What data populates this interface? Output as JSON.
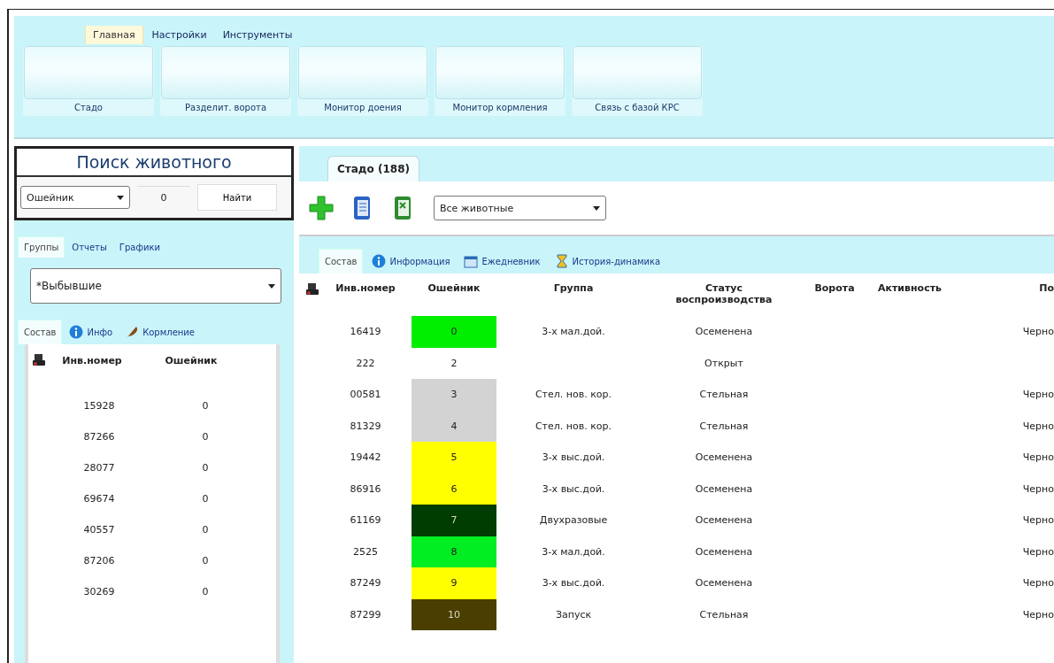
{
  "ribbon": {
    "tabs": [
      {
        "label": "Главная",
        "selected": true
      },
      {
        "label": "Настройки",
        "selected": false
      },
      {
        "label": "Инструменты",
        "selected": false
      }
    ],
    "buttons": [
      "Стадо",
      "Разделит. ворота",
      "Монитор доения",
      "Монитор кормления",
      "Связь с базой КРС"
    ]
  },
  "search": {
    "title": "Поиск животного",
    "field": "Ошейник",
    "value": "0",
    "button": "Найти"
  },
  "left_tabs": [
    {
      "label": "Группы",
      "selected": true
    },
    {
      "label": "Отчеты",
      "selected": false
    },
    {
      "label": "Графики",
      "selected": false
    }
  ],
  "group_select": "*Выбывшие",
  "left_subtabs": [
    {
      "label": "Состав",
      "selected": true
    },
    {
      "label": "Инфо",
      "selected": false
    },
    {
      "label": "Кормление",
      "selected": false
    }
  ],
  "left_table": {
    "columns": [
      "Инв.номер",
      "Ошейник"
    ],
    "rows": [
      [
        "15928",
        "0"
      ],
      [
        "87266",
        "0"
      ],
      [
        "28077",
        "0"
      ],
      [
        "69674",
        "0"
      ],
      [
        "40557",
        "0"
      ],
      [
        "87206",
        "0"
      ],
      [
        "30269",
        "0"
      ]
    ]
  },
  "main_tab": {
    "label": "Стадо (188)",
    "selected": true
  },
  "filter_select": "Все животные",
  "main_subtabs": [
    {
      "label": "Состав",
      "selected": true
    },
    {
      "label": "Информация",
      "selected": false
    },
    {
      "label": "Ежедневник",
      "selected": false
    },
    {
      "label": "История-динамика",
      "selected": false
    }
  ],
  "table": {
    "columns": [
      "Инв.номер",
      "Ошейник",
      "Группа",
      "Статус воспроизводства",
      "Ворота",
      "Активность",
      "По"
    ],
    "rows": [
      {
        "id": "16419",
        "collar": "0",
        "color": "#00ee00",
        "group": "3-х мал.дой.",
        "status": "Осеменена",
        "col_7": "Черно"
      },
      {
        "id": "222",
        "collar": "2",
        "group": "",
        "status": "Открыт",
        "col_7": ""
      },
      {
        "id": "00581",
        "collar": "3",
        "color": "#d3d3d3",
        "group": "Стел. нов. кор.",
        "status": "Стельная",
        "col_7": "Черно"
      },
      {
        "id": "81329",
        "collar": "4",
        "color": "#d3d3d3",
        "group": "Стел. нов. кор.",
        "status": "Стельная",
        "col_7": "Черно"
      },
      {
        "id": "19442",
        "collar": "5",
        "color": "#ffff00",
        "group": "3-х выс.дой.",
        "status": "Осеменена",
        "col_7": "Черно"
      },
      {
        "id": "86916",
        "collar": "6",
        "color": "#ffff00",
        "group": "3-х выс.дой.",
        "status": "Осеменена",
        "col_7": "Черно"
      },
      {
        "id": "61169",
        "collar": "7",
        "color": "#003d00",
        "group": "Двухразовые",
        "status": "Осеменена",
        "col_7": "Черно"
      },
      {
        "id": "2525",
        "collar": "8",
        "color": "#00ee22",
        "group": "3-х мал.дой.",
        "status": "Осеменена",
        "col_7": "Черно"
      },
      {
        "id": "87249",
        "collar": "9",
        "color": "#ffff00",
        "group": "3-х выс.дой.",
        "status": "Осеменена",
        "col_7": "Черно"
      },
      {
        "id": "87299",
        "collar": "10",
        "color": "#4a3f00",
        "group": "Запуск",
        "status": "Стельная",
        "col_7": "Черно"
      }
    ]
  }
}
